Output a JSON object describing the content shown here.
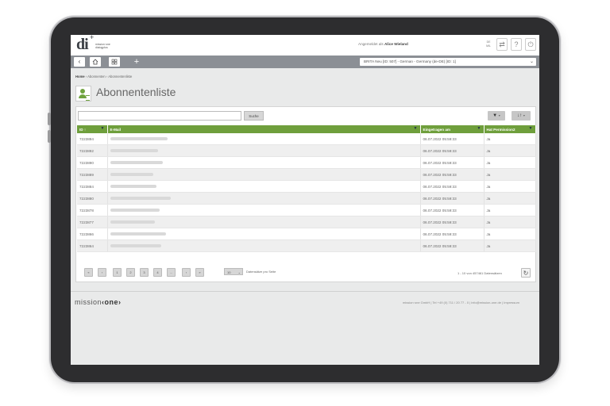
{
  "header": {
    "logo_mark": "di",
    "logo_plus": "+",
    "logo_line1": "mission·one",
    "logo_line2": "dialogplus",
    "logged_in_prefix": "Angemeldet als",
    "logged_in_user": "Alice Wieland",
    "lang_code": "DE",
    "lang_code2": "MIL",
    "sync_icon": "sync-icon",
    "help_label": "?",
    "power_icon": "power-icon"
  },
  "nav": {
    "back_label": "‹",
    "home_icon": "home-icon",
    "grid_icon": "grid-icon",
    "add_label": "+",
    "shop_select_value": "BRITA Neu [ID: 507] - German - Germany (de-DE) [ID: 1]"
  },
  "breadcrumb": {
    "home": "Home",
    "separator": " › ",
    "section": "Abonnenten",
    "current": "Abonnentenliste"
  },
  "page": {
    "title": "Abonnentenliste"
  },
  "toolbar": {
    "search_value": "",
    "search_button": "Suche",
    "filter_icon": "▼",
    "sort_icon": "↓↑",
    "caret": "▾"
  },
  "table": {
    "columns": [
      "ID ↑",
      "E-Mail",
      "Eingetragen am",
      "Hat Permission2"
    ],
    "rows": [
      {
        "id": "7223894",
        "date": "06.07.2022 05:59:33",
        "perm": "Ja"
      },
      {
        "id": "7223892",
        "date": "06.07.2022 05:59:33",
        "perm": "Ja"
      },
      {
        "id": "7223890",
        "date": "06.07.2022 05:59:33",
        "perm": "Ja"
      },
      {
        "id": "7223889",
        "date": "06.07.2022 05:59:33",
        "perm": "Ja"
      },
      {
        "id": "7223884",
        "date": "06.07.2022 05:59:33",
        "perm": "Ja"
      },
      {
        "id": "7223880",
        "date": "06.07.2022 05:59:33",
        "perm": "Ja"
      },
      {
        "id": "7223878",
        "date": "06.07.2022 05:59:33",
        "perm": "Ja"
      },
      {
        "id": "7223877",
        "date": "06.07.2022 05:59:33",
        "perm": "Ja"
      },
      {
        "id": "7223866",
        "date": "06.07.2022 05:59:33",
        "perm": "Ja"
      },
      {
        "id": "7223864",
        "date": "06.07.2022 05:59:33",
        "perm": "Ja"
      }
    ]
  },
  "pagination": {
    "first": "«",
    "prev": "‹",
    "pages": [
      "1",
      "2",
      "3",
      "4",
      "…"
    ],
    "next": "›",
    "last": "»",
    "per_page_value": "10",
    "per_page_label": "Datensätze pro Seite",
    "count_text": "1 - 10 von 457461 Datensätzen"
  },
  "footer": {
    "logo_text1": "mission",
    "logo_text2": "‹one›",
    "text": "mission·one GmbH | Tel +49 (0) 711 / 20 77 - 0 | info@mission-one.de | Impressum"
  },
  "colors": {
    "accent_green": "#6f9f3c",
    "navbar_gray": "#8b8f95"
  }
}
